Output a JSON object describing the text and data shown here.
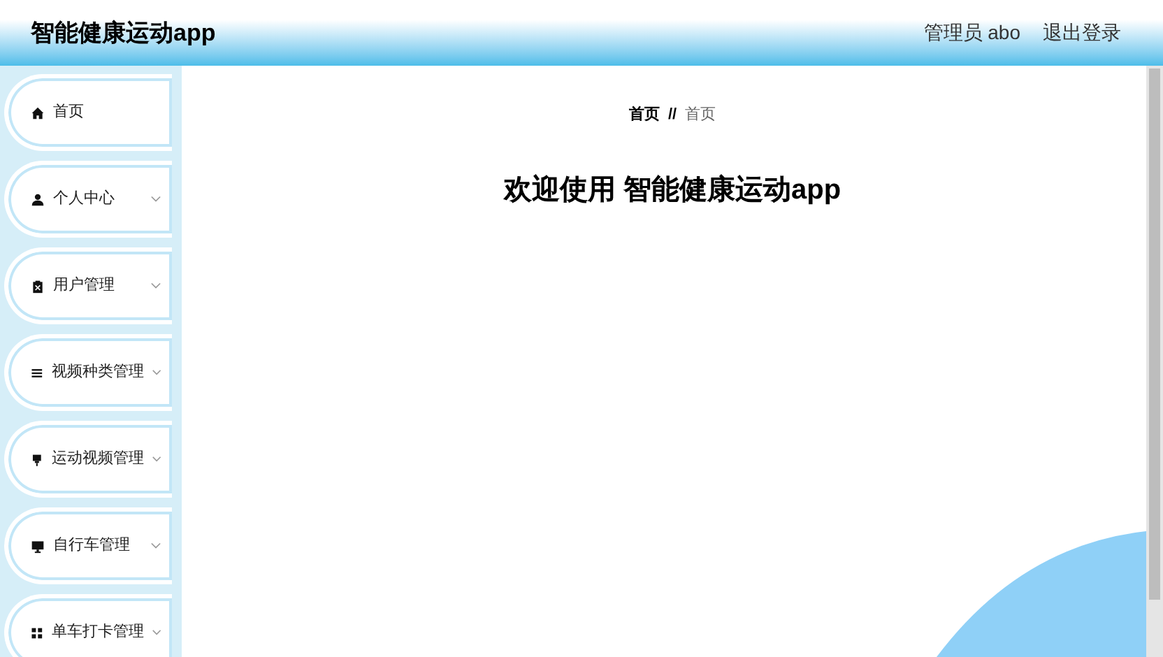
{
  "header": {
    "title": "智能健康运动app",
    "user": "管理员 abo",
    "logout": "退出登录"
  },
  "sidebar": {
    "items": [
      {
        "label": "首页",
        "kind": "link"
      },
      {
        "label": "个人中心",
        "kind": "menu"
      },
      {
        "label": "用户管理",
        "kind": "menu"
      },
      {
        "label": "视频种类管理",
        "kind": "menu"
      },
      {
        "label": "运动视频管理",
        "kind": "menu"
      },
      {
        "label": "自行车管理",
        "kind": "menu"
      },
      {
        "label": "单车打卡管理",
        "kind": "menu"
      }
    ]
  },
  "breadcrumb": [
    "首页",
    "//",
    "首页"
  ],
  "welcome": "欢迎使用 智能健康运动app"
}
